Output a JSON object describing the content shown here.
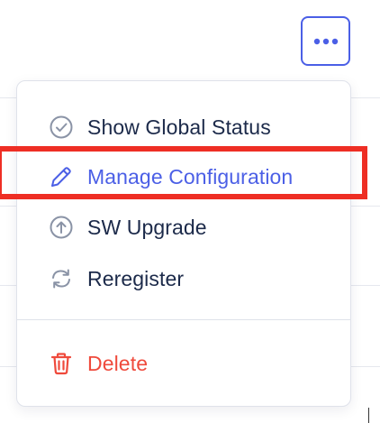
{
  "toolbar": {
    "more_icon": "ellipsis-icon",
    "accent_color": "#4b5fe6"
  },
  "menu": {
    "items": [
      {
        "label": "Show Global Status",
        "icon": "check-circle-icon",
        "color": "#1c2a4a"
      },
      {
        "label": "Manage Configuration",
        "icon": "pencil-icon",
        "color": "#4b5fe6"
      },
      {
        "label": "SW Upgrade",
        "icon": "arrow-up-circle-icon",
        "color": "#1c2a4a"
      },
      {
        "label": "Reregister",
        "icon": "refresh-icon",
        "color": "#1c2a4a"
      }
    ],
    "danger_item": {
      "label": "Delete",
      "icon": "trash-icon",
      "color": "#ef4a3c"
    }
  },
  "annotation": {
    "highlight_color": "#ee2e24",
    "highlighted_item": "Manage Configuration"
  }
}
